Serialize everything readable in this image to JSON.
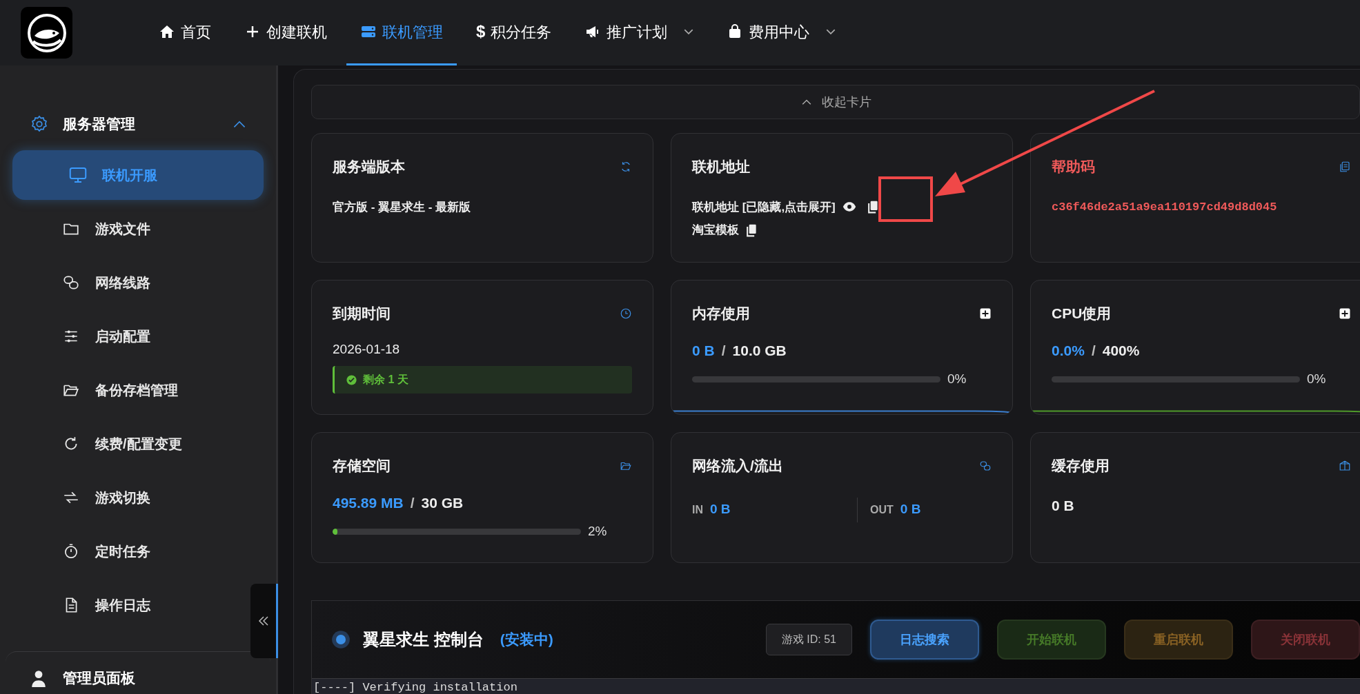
{
  "nav": {
    "items": [
      {
        "label": "首页",
        "selected": false,
        "dropdown": false
      },
      {
        "label": "创建联机",
        "selected": false,
        "dropdown": false
      },
      {
        "label": "联机管理",
        "selected": true,
        "dropdown": false
      },
      {
        "label": "积分任务",
        "selected": false,
        "dropdown": false,
        "glyph": "$"
      },
      {
        "label": "推广计划",
        "selected": false,
        "dropdown": true
      },
      {
        "label": "费用中心",
        "selected": false,
        "dropdown": true
      }
    ]
  },
  "sidebar": {
    "group": {
      "label": "服务器管理",
      "expanded": true
    },
    "items": [
      {
        "label": "联机开服",
        "selected": true
      },
      {
        "label": "游戏文件",
        "selected": false
      },
      {
        "label": "网络线路",
        "selected": false
      },
      {
        "label": "启动配置",
        "selected": false
      },
      {
        "label": "备份存档管理",
        "selected": false
      },
      {
        "label": "续费/配置变更",
        "selected": false
      },
      {
        "label": "游戏切换",
        "selected": false
      },
      {
        "label": "定时任务",
        "selected": false
      },
      {
        "label": "操作日志",
        "selected": false
      }
    ],
    "footer_group": {
      "label": "管理员面板"
    }
  },
  "collapse_cards": {
    "label": "收起卡片"
  },
  "cards": [
    {
      "kind": "version",
      "title": "服务端版本",
      "value": "官方版 - 翼星求生 - 最新版"
    },
    {
      "kind": "address",
      "title": "联机地址",
      "address": "联机地址 [已隐藏,点击展开]",
      "template": "淘宝模板"
    },
    {
      "kind": "help_code",
      "title": "帮助码",
      "code": "c36f46de2a51a9ea110197cd49d8d045"
    },
    {
      "kind": "expiry",
      "title": "到期时间",
      "date": "2026-01-18",
      "remaining": "剩余 1 天"
    },
    {
      "kind": "memory",
      "title": "内存使用",
      "used": "0 B",
      "separator": "/",
      "total": "10.0 GB",
      "level": 0,
      "percent": "0%"
    },
    {
      "kind": "cpu",
      "title": "CPU使用",
      "used": "0.0%",
      "separator": "/",
      "total": "400%",
      "level": 0,
      "percent": "0%"
    },
    {
      "kind": "storage",
      "title": "存储空间",
      "used": "495.89 MB",
      "separator": "/",
      "total": "30 GB",
      "level": 0.02,
      "percent": "2%"
    },
    {
      "kind": "network",
      "title": "网络流入/流出",
      "in_label": "IN",
      "in_value": "0 B",
      "out_label": "OUT",
      "out_value": "0 B"
    },
    {
      "kind": "cache",
      "title": "缓存使用",
      "value": "0 B"
    }
  ],
  "console": {
    "title": "翼星求生 控制台",
    "status": "(安装中)",
    "game_id": "游戏 ID: 51",
    "buttons": [
      {
        "label": "日志搜索",
        "kind": "search"
      },
      {
        "label": "开始联机",
        "kind": "start"
      },
      {
        "label": "重启联机",
        "kind": "restart"
      },
      {
        "label": "关闭联机",
        "kind": "stop"
      }
    ],
    "log_line": "[----] Verifying installation"
  }
}
